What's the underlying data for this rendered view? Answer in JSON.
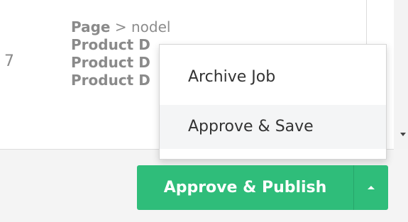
{
  "table": {
    "row_number": "7",
    "paths": [
      {
        "strong": "Page",
        "rest": " > nodel"
      },
      {
        "strong": "Product D",
        "rest": ""
      },
      {
        "strong": "Product D",
        "rest": ""
      },
      {
        "strong": "Product D",
        "rest": ""
      }
    ]
  },
  "dropdown": {
    "items": [
      {
        "label": "Archive Job"
      },
      {
        "label": "Approve & Save"
      }
    ]
  },
  "actions": {
    "primary_label": "Approve & Publish"
  },
  "colors": {
    "primary_green": "#2fbd7a",
    "menu_hover_bg": "#f4f5f6"
  },
  "icons": {
    "split_toggle": "caret-up-icon",
    "scroll_down": "scroll-down-arrow-icon"
  }
}
